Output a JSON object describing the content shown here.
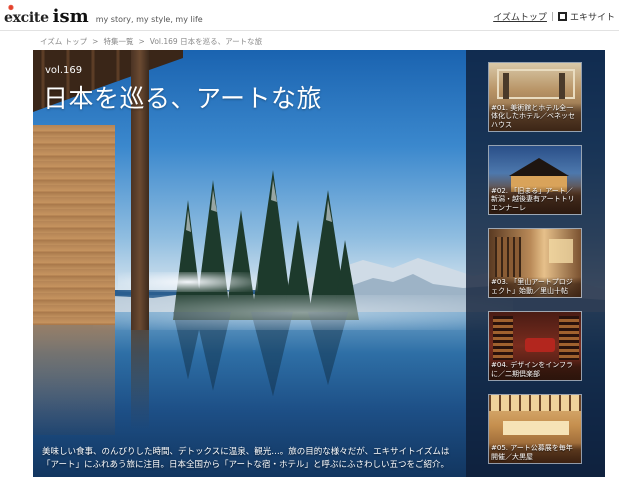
{
  "header": {
    "logo_excite": "excite",
    "logo_ism": "ism",
    "tagline": "my story, my style, my life",
    "link_ism_top": "イズムトップ",
    "link_excite": "エキサイト"
  },
  "breadcrumb": {
    "items": [
      "イズム トップ",
      ">",
      "特集一覧",
      ">",
      "Vol.169 日本を巡る、アートな旅"
    ]
  },
  "hero": {
    "vol": "vol.169",
    "title": "日本を巡る、アートな旅",
    "description_line1": "美味しい食事、のんびりした時間、デトックスに温泉、観光…。旅の目的な様々だが、エキサイトイズムは",
    "description_line2": "「アート」にふれあう旅に注目。日本全国から「アートな宿・ホテル」と呼ぶにふさわしい五つをご紹介。"
  },
  "side_items": [
    {
      "caption": "#01. 美術館とホテル全一体化したホテル／ベネッセハウス"
    },
    {
      "caption": "#02. 「旧まる」アート／新潟・越後妻有アートトリエンナーレ"
    },
    {
      "caption": "#03. 「里山アートプロジェクト」始動／里山十帖"
    },
    {
      "caption": "#04. デザインをインフラに／二期倶楽部"
    },
    {
      "caption": "#05. アート公募展を毎年開催／大黒屋"
    }
  ],
  "icons": {
    "excite_square": "excite-square-icon",
    "logo_spark": "logo-spark-icon"
  },
  "colors": {
    "panel": "#0e1c34",
    "sky": "#1a63b0",
    "water": "#1d4f86"
  }
}
